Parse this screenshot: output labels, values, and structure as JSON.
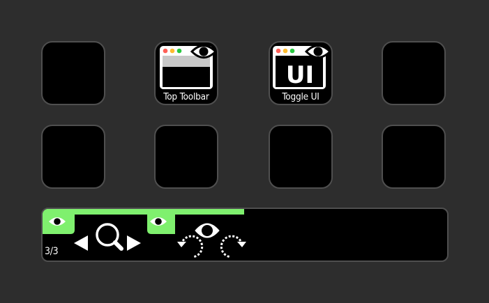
{
  "keys": [
    {
      "label": "",
      "icon": "empty"
    },
    {
      "label": "Top Toolbar",
      "icon": "window-eye-icon"
    },
    {
      "label": "Toggle UI",
      "icon": "window-ui-eye-icon"
    },
    {
      "label": "",
      "icon": "empty"
    },
    {
      "label": "",
      "icon": "empty"
    },
    {
      "label": "",
      "icon": "empty"
    },
    {
      "label": "",
      "icon": "empty"
    },
    {
      "label": "",
      "icon": "empty"
    }
  ],
  "toggle_ui_icon_text": "UI",
  "touch_strip": {
    "page_counter": "3/3",
    "dials": [
      {
        "icon": "eye-icon",
        "controls": [
          "previous-arrow-icon",
          "magnifier-icon",
          "next-arrow-icon"
        ]
      },
      {
        "icon": "eye-icon",
        "controls": [
          "rotate-left-icon",
          "eye-icon",
          "rotate-right-icon"
        ]
      }
    ]
  },
  "colors": {
    "background": "#2d2d2d",
    "key": "#000000",
    "key_border": "#4f4f4f",
    "accent_green": "#7ff06e",
    "traffic_red": "#ff5f57",
    "traffic_yellow": "#febc2e",
    "traffic_green": "#28c840"
  }
}
